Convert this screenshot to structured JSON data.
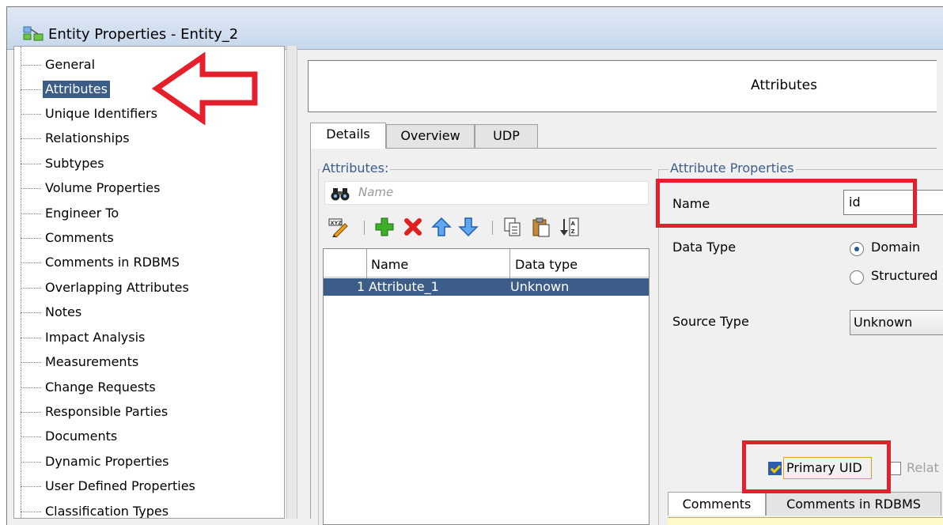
{
  "window": {
    "title": "Entity Properties - Entity_2"
  },
  "tree": {
    "items": [
      {
        "label": "General"
      },
      {
        "label": "Attributes",
        "selected": true
      },
      {
        "label": "Unique Identifiers"
      },
      {
        "label": "Relationships"
      },
      {
        "label": "Subtypes"
      },
      {
        "label": "Volume Properties"
      },
      {
        "label": "Engineer To"
      },
      {
        "label": "Comments"
      },
      {
        "label": "Comments in RDBMS"
      },
      {
        "label": "Overlapping Attributes"
      },
      {
        "label": "Notes"
      },
      {
        "label": "Impact Analysis"
      },
      {
        "label": "Measurements"
      },
      {
        "label": "Change Requests"
      },
      {
        "label": "Responsible Parties"
      },
      {
        "label": "Documents"
      },
      {
        "label": "Dynamic Properties"
      },
      {
        "label": "User Defined Properties"
      },
      {
        "label": "Classification Types"
      }
    ]
  },
  "header": {
    "title": "Attributes"
  },
  "tabs": [
    {
      "label": "Details",
      "active": true
    },
    {
      "label": "Overview"
    },
    {
      "label": "UDP"
    }
  ],
  "attributes_panel": {
    "group_title": "Attributes:",
    "filter_placeholder": "Name",
    "grid": {
      "columns": [
        "Name",
        "Data type"
      ],
      "rows": [
        {
          "index": "1",
          "name": "Attribute_1",
          "data_type": "Unknown"
        }
      ]
    }
  },
  "attribute_properties": {
    "group_title": "Attribute Properties",
    "name_label": "Name",
    "name_value": "id",
    "data_type_label": "Data Type",
    "data_type_options": [
      "Domain",
      "Structured"
    ],
    "data_type_selected": "Domain",
    "source_type_label": "Source Type",
    "source_type_value": "Unknown",
    "primary_uid_label": "Primary UID",
    "primary_uid_checked": true,
    "relation_uid_label": "Relat"
  },
  "bottom_tabs": [
    {
      "label": "Comments",
      "active": true
    },
    {
      "label": "Comments in RDBMS"
    }
  ],
  "colors": {
    "selection": "#3b5d87",
    "highlight_red": "#e3202b",
    "group_title": "#3b5d87"
  }
}
